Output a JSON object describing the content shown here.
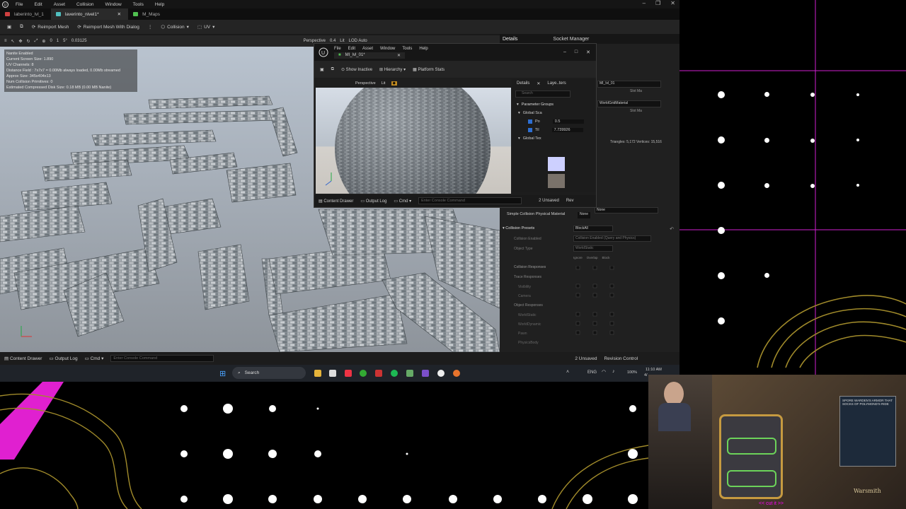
{
  "menu": [
    "File",
    "Edit",
    "Asset",
    "Collision",
    "Window",
    "Tools",
    "Help"
  ],
  "tabs": [
    {
      "label": "laberinto_lvl_1",
      "color": "#d04040"
    },
    {
      "label": "laverinto_nivel1*",
      "color": "#50c0c0"
    },
    {
      "label": "M_Maps",
      "color": "#50c050"
    }
  ],
  "toolbar": {
    "reimport": "Reimport Mesh",
    "reimport_dialog": "Reimport Mesh With Dialog",
    "collision": "Collision",
    "uv": "UV"
  },
  "vp_toolbar": {
    "zero": "0",
    "one": "1",
    "five": "5°",
    "scale": "0.03125",
    "perspective": "Perspective",
    "zoom": "0.4",
    "lit": "Lit",
    "lod": "LOD Auto"
  },
  "stats": [
    "Nanite Enabled",
    "Current Screen Size: 1.890",
    "UV Channels: 8",
    "Distance Field : 7x7x7 = 0.00Mb always loaded, 0.00Mb streamed",
    "Approx Size: 345x404x13",
    "Num Collision Primitives: 0",
    "Estimated Compressed Disk Size: 0.18 MB (0.00 MB Nanite)"
  ],
  "right_tabs": {
    "details": "Details",
    "socket": "Socket Manager"
  },
  "mi": {
    "title": "MI_lvl_01*",
    "menu": [
      "File",
      "Edit",
      "Asset",
      "Window",
      "Tools",
      "Help"
    ],
    "show_inactive": "Show Inactive",
    "hierarchy": "Hierarchy",
    "platform": "Platform Stats",
    "perspective": "Perspective",
    "lit": "Lit",
    "details_tab": "Details",
    "layer_tab": "Laye..ters",
    "search_ph": "Search",
    "param_groups": "Parameter Groups",
    "global_sca": "Global Sca",
    "po": "Po",
    "po_val": "0.5",
    "til": "Til",
    "til_val": "7.739926",
    "global_tex": "Global Tex",
    "content_drawer": "Content Drawer",
    "output_log": "Output Log",
    "cmd": "Cmd",
    "console_ph": "Enter Console Command",
    "unsaved": "2 Unsaved",
    "rev": "Rev"
  },
  "rp": {
    "slot1": "MI_lvl_01",
    "slot2": "WorldGridMaterial",
    "slot": "Slot",
    "ma": "Ma",
    "triangles": "Triangles: 5,172   Vertices: 15,516",
    "simple_coll": "Simple Collision Physical Material",
    "none": "None",
    "collision_presets": "Collision Presets",
    "preset_val": "BlockAll",
    "coll_enabled": "Collision Enabled",
    "coll_enabled_val": "Collision Enabled (Query and Physics)",
    "object_type": "Object Type",
    "object_type_val": "WorldStatic",
    "cols": [
      "Ignore",
      "Overlap",
      "Block"
    ],
    "coll_resp": "Collision Responses",
    "trace_resp": "Trace Responses",
    "visibility": "Visibility",
    "camera": "Camera",
    "obj_resp": "Object Responses",
    "worldstatic": "WorldStatic",
    "worlddynamic": "WorldDynamic",
    "pawn": "Pawn",
    "physicsbody": "PhysicsBody"
  },
  "bottom": {
    "content_drawer": "Content Drawer",
    "output_log": "Output Log",
    "cmd": "Cmd",
    "console_ph": "Enter Console Command",
    "unsaved": "2 Unsaved",
    "revision": "Revision Control"
  },
  "taskbar": {
    "search": "Search",
    "lang": "ENG",
    "battery": "100%",
    "time": "11:10 AM",
    "date": "4/"
  },
  "overlay": {
    "caption": "<< cut it >>",
    "brand": "Warsmith",
    "game_text": "SPORE WARDEN'S ARMOR THAT SOCKS OF POLYMOND'S RIDE"
  }
}
